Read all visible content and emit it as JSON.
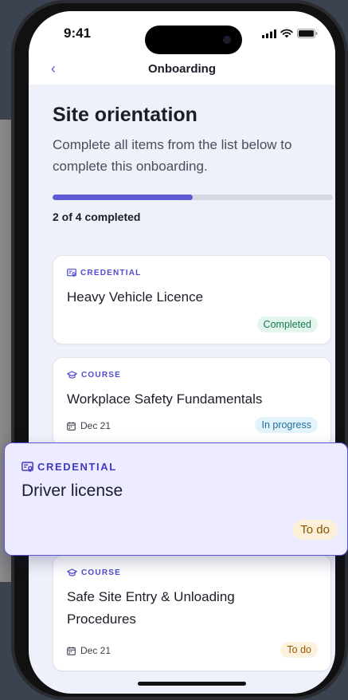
{
  "status": {
    "time": "9:41"
  },
  "nav": {
    "title": "Onboarding",
    "back_icon": "chevron-left-icon"
  },
  "page": {
    "title": "Site orientation",
    "subtitle": "Complete all items from the list below to complete this onboarding.",
    "progress": {
      "completed": 2,
      "total": 4,
      "fraction": 0.5,
      "label": "2 of 4 completed"
    }
  },
  "items": [
    {
      "type": "CREDENTIAL",
      "icon": "credential-icon",
      "title": "Heavy Vehicle Licence",
      "date": "",
      "status": "Completed"
    },
    {
      "type": "COURSE",
      "icon": "graduation-cap-icon",
      "title": "Workplace Safety Fundamentals",
      "date": "Dec 21",
      "status": "In progress"
    },
    {
      "type": "COURSE",
      "icon": "graduation-cap-icon",
      "title": "Safe Site Entry & Unloading Procedures",
      "date": "Dec 21",
      "status": "To do"
    }
  ],
  "dragged_item": {
    "type": "CREDENTIAL",
    "icon": "credential-icon",
    "title": "Driver license",
    "status": "To do"
  },
  "colors": {
    "accent": "#5d5ad6",
    "completed_bg": "#e3f6ee",
    "completed_fg": "#157a50",
    "progress_bg": "#e3f3fb",
    "progress_fg": "#1e6f9e",
    "todo_bg": "#fdf2dd",
    "todo_fg": "#9a5a00"
  }
}
